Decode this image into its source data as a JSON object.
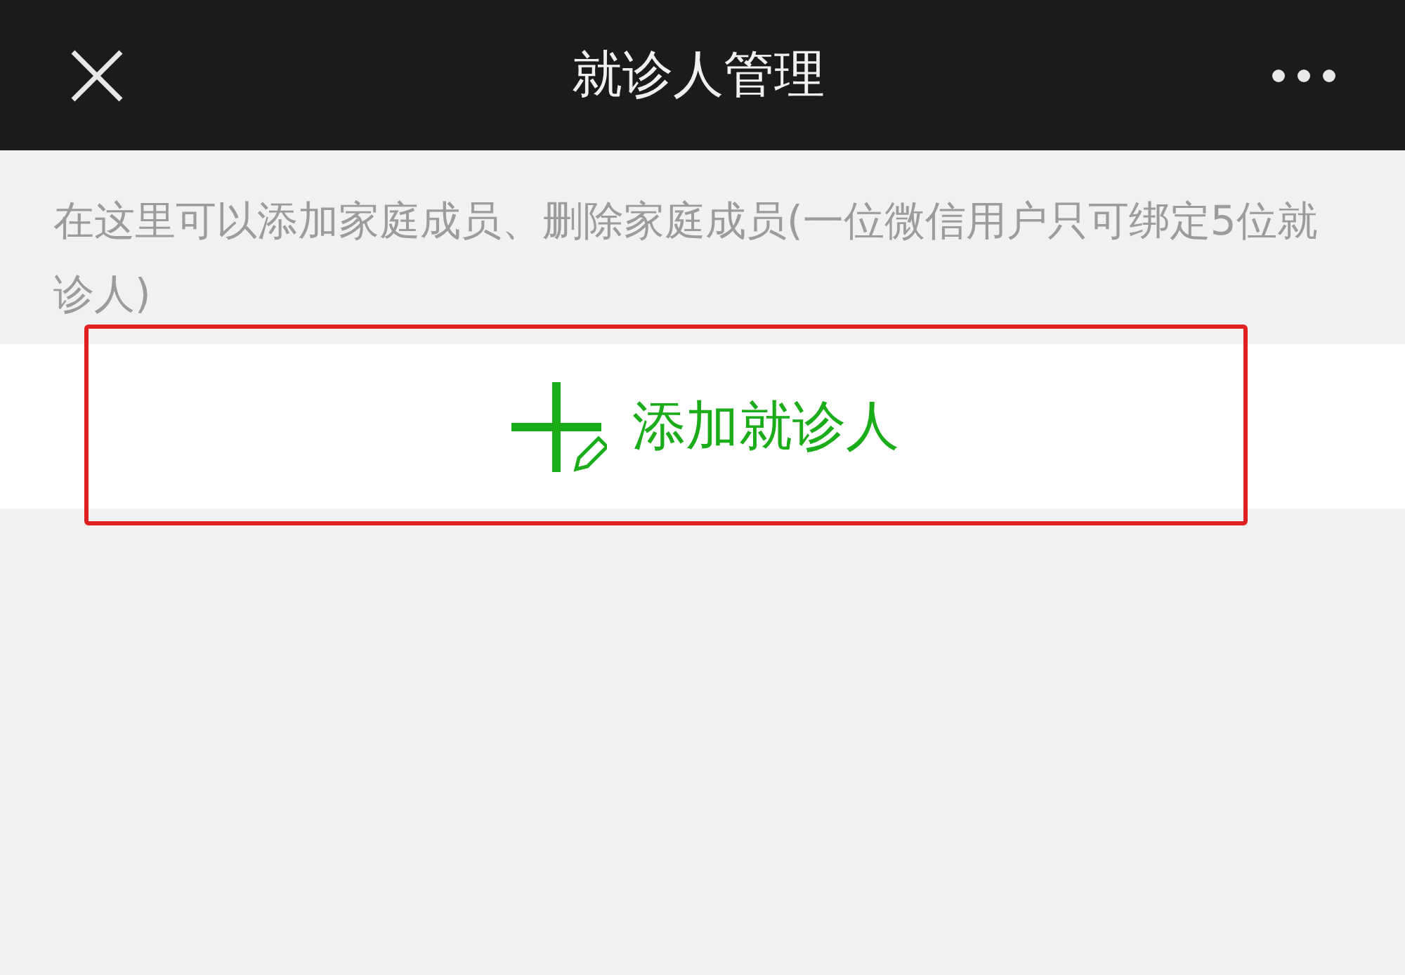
{
  "header": {
    "title": "就诊人管理"
  },
  "notice": "在这里可以添加家庭成员、删除家庭成员(一位微信用户只可绑定5位就诊人)",
  "add_button": {
    "label": "添加就诊人",
    "highlighted": true
  }
}
